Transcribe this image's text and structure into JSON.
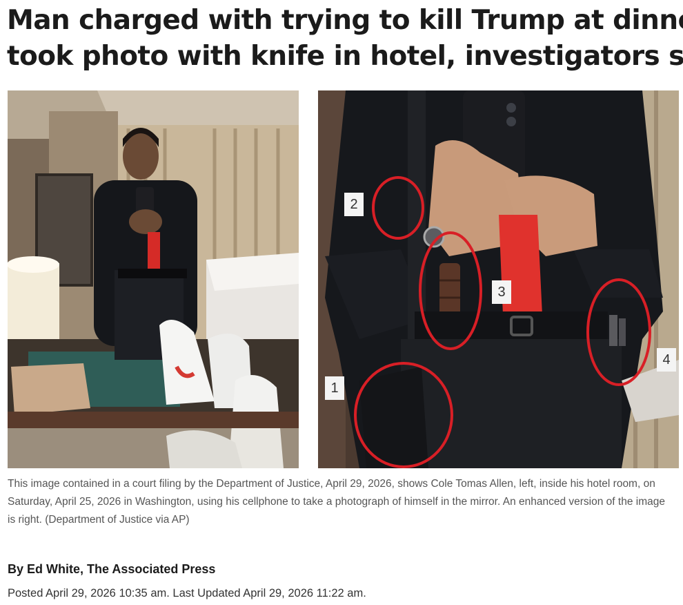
{
  "article": {
    "headline_line1": "Man charged with trying to kill Trump at dinner",
    "headline_line2": "took photo with knife in hotel, investigators say",
    "caption": "This image contained in a court filing by the Department of Justice, April 29, 2026, shows Cole Tomas Allen, left, inside his hotel room, on Saturday, April 25, 2026 in Washington, using his cellphone to take a photograph of himself in the mirror. An enhanced version of the image is right. (Department of Justice via AP)",
    "byline": "By Ed White, The Associated Press",
    "posted": "Posted April 29, 2026 10:35 am.  Last Updated April 29, 2026 11:22 am."
  },
  "photo": {
    "markers": [
      "1",
      "2",
      "3",
      "4"
    ]
  },
  "colors": {
    "circle": "#d81f26",
    "tie": "#e0322d",
    "headline": "#1b1b1b"
  }
}
